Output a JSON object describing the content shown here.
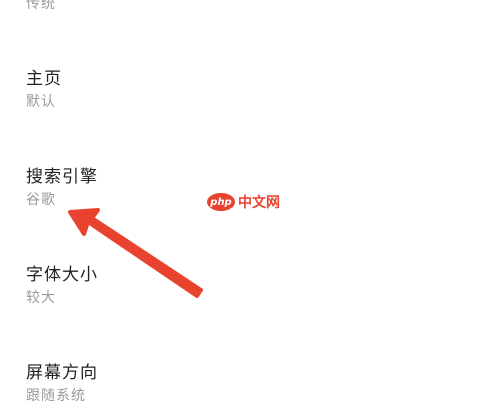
{
  "settings": {
    "items": [
      {
        "title": "",
        "value": "传统"
      },
      {
        "title": "主页",
        "value": "默认"
      },
      {
        "title": "搜索引擎",
        "value": "谷歌"
      },
      {
        "title": "字体大小",
        "value": "较大"
      },
      {
        "title": "屏幕方向",
        "value": "跟随系统"
      }
    ]
  },
  "watermark": {
    "badge_text": "php",
    "site_text": "中文网"
  },
  "annotation": {
    "arrow_color": "#e8432f"
  }
}
